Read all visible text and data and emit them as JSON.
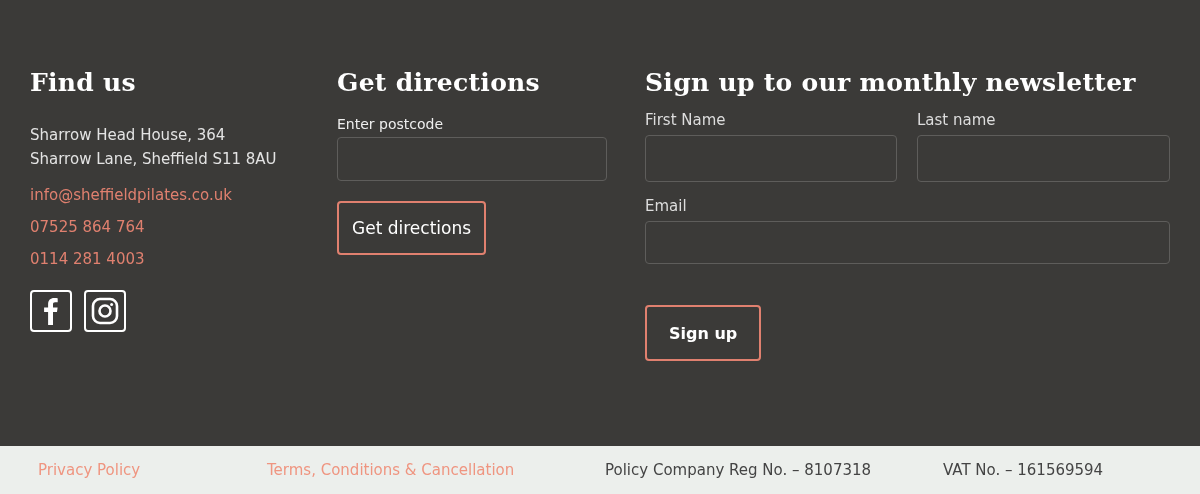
{
  "find_us": {
    "heading": "Find us",
    "address": [
      "Sharrow Head House, 364",
      "Sharrow Lane, Sheffield S11 8AU"
    ],
    "contacts": [
      "info@sheffieldpilates.co.uk",
      "07525 864 764",
      "0114 281 4003"
    ],
    "social": [
      {
        "kind": "facebook"
      },
      {
        "kind": "instagram"
      }
    ]
  },
  "directions": {
    "heading": "Get directions",
    "field_label": "Enter postcode",
    "button": "Get directions"
  },
  "newsletter": {
    "heading": "Sign up to our monthly newsletter",
    "fields": [
      {
        "label": "First Name"
      },
      {
        "label": "Last name"
      },
      {
        "label": "Email"
      }
    ],
    "button": "Sign up"
  },
  "footer_bar": {
    "links": [
      "Privacy Policy",
      "Terms, Conditions & Cancellation"
    ],
    "notes": [
      "Policy Company Reg No. – 8107318",
      "VAT No. – 161569594"
    ]
  }
}
